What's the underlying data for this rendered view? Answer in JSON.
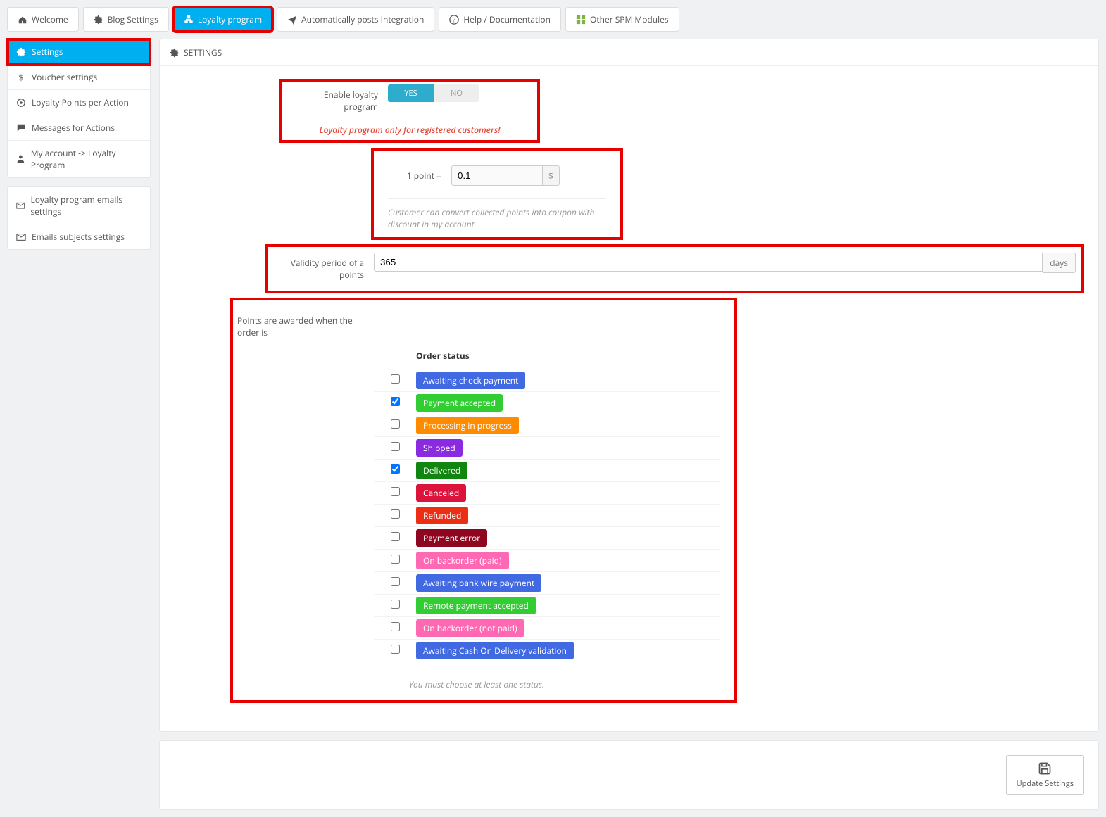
{
  "tabs": [
    {
      "label": "Welcome",
      "icon": "home"
    },
    {
      "label": "Blog Settings",
      "icon": "cogs"
    },
    {
      "label": "Loyalty program",
      "icon": "sitemap",
      "active": true
    },
    {
      "label": "Automatically posts Integration",
      "icon": "plane"
    },
    {
      "label": "Help / Documentation",
      "icon": "help"
    },
    {
      "label": "Other SPM Modules",
      "icon": "modules"
    }
  ],
  "sidebar_groups": [
    [
      {
        "label": "Settings",
        "icon": "cogs",
        "active": true
      },
      {
        "label": "Voucher settings",
        "icon": "dollar"
      },
      {
        "label": "Loyalty Points per Action",
        "icon": "target"
      },
      {
        "label": "Messages for Actions",
        "icon": "comment"
      },
      {
        "label": "My account -> Loyalty Program",
        "icon": "user"
      }
    ],
    [
      {
        "label": "Loyalty program emails settings",
        "icon": "envelope"
      },
      {
        "label": "Emails subjects settings",
        "icon": "envelope"
      }
    ]
  ],
  "panel_title": "SETTINGS",
  "enable_label": "Enable loyalty program",
  "toggle": {
    "yes": "YES",
    "no": "NO"
  },
  "warn": "Loyalty program only for registered customers!",
  "point_label": "1 point =",
  "point_value": "0.1",
  "currency": "$",
  "point_help": "Customer can convert collected points into coupon with discount in my account",
  "validity_label": "Validity period of a points",
  "validity_value": "365",
  "validity_unit": "days",
  "awarded_label": "Points are awarded when the order is",
  "status_header": "Order status",
  "must_choose": "You must choose at least one status.",
  "update_btn": "Update Settings",
  "statuses": [
    {
      "label": "Awaiting check payment",
      "color": "#4169e1",
      "checked": false
    },
    {
      "label": "Payment accepted",
      "color": "#32cd32",
      "checked": true
    },
    {
      "label": "Processing in progress",
      "color": "#ff8c00",
      "checked": false
    },
    {
      "label": "Shipped",
      "color": "#8a2be2",
      "checked": false
    },
    {
      "label": "Delivered",
      "color": "#108510",
      "checked": true
    },
    {
      "label": "Canceled",
      "color": "#dc143c",
      "checked": false
    },
    {
      "label": "Refunded",
      "color": "#ec2e15",
      "checked": false
    },
    {
      "label": "Payment error",
      "color": "#8f0621",
      "checked": false
    },
    {
      "label": "On backorder (paid)",
      "color": "#ff69b4",
      "checked": false
    },
    {
      "label": "Awaiting bank wire payment",
      "color": "#4169e1",
      "checked": false
    },
    {
      "label": "Remote payment accepted",
      "color": "#32cd32",
      "checked": false
    },
    {
      "label": "On backorder (not paid)",
      "color": "#ff69b4",
      "checked": false
    },
    {
      "label": "Awaiting Cash On Delivery validation",
      "color": "#4169e1",
      "checked": false
    }
  ]
}
